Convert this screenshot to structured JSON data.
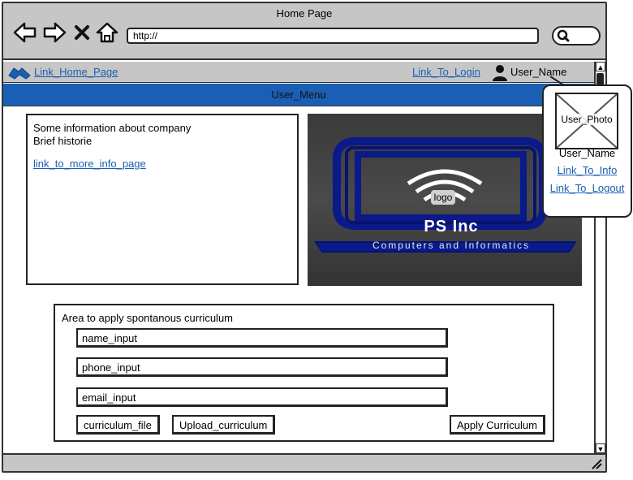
{
  "browser": {
    "title": "Home Page",
    "url": "http://",
    "icons": [
      "back-arrow-icon",
      "forward-arrow-icon",
      "close-icon",
      "home-icon",
      "search-icon"
    ]
  },
  "linkbar": {
    "home_link": "Link_Home_Page",
    "login_link": "Link_To_Login",
    "user_name": "User_Name"
  },
  "menu": {
    "label": "User_Menu",
    "color": "#1a5fb4"
  },
  "info": {
    "line1": "Some information about company",
    "line2": "Brief historie",
    "more_link": "link_to_more_info_page"
  },
  "logo": {
    "tag": "logo",
    "company": "PS Inc",
    "tagline": "Computers and Informatics"
  },
  "curriculum": {
    "title": "Area to apply spontanous curriculum",
    "name_input": "name_input",
    "phone_input": "phone_input",
    "email_input": "email_input",
    "file_button": "curriculum_file",
    "upload_button": "Upload_curriculum",
    "apply_button": "Apply Curriculum"
  },
  "user_popup": {
    "photo_label": "User_Photo",
    "name": "User_Name",
    "info_link": "Link_To_Info",
    "logout_link": "Link_To_Logout"
  }
}
